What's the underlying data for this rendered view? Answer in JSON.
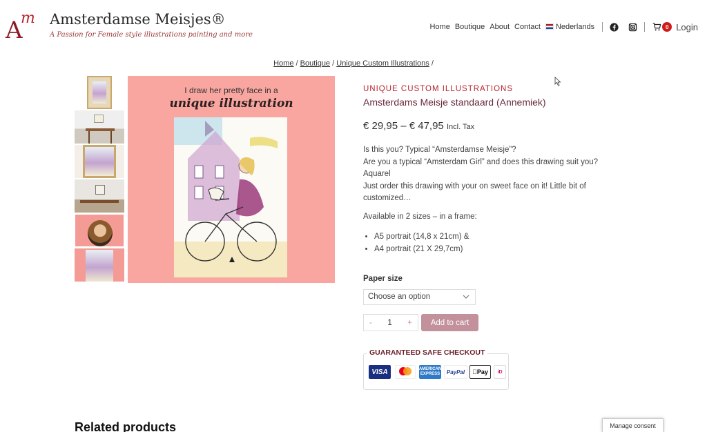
{
  "header": {
    "site_title": "Amsterdamse Meisjes®",
    "tagline": "A Passion for Female style illustrations painting and more",
    "nav": [
      "Home",
      "Boutique",
      "About",
      "Contact"
    ],
    "language": "Nederlands",
    "cart_count": "0",
    "login": "Login",
    "icons": [
      "facebook-icon",
      "instagram-icon",
      "cart-icon",
      "netherlands-flag-icon"
    ]
  },
  "breadcrumb": {
    "items": [
      "Home",
      "Boutique",
      "Unique Custom Illustrations"
    ],
    "separator": "/"
  },
  "gallery": {
    "main_line1": "I draw her pretty face in a",
    "main_line2": "unique illustration"
  },
  "product": {
    "category": "UNIQUE CUSTOM ILLUSTRATIONS",
    "title": "Amsterdams Meisje standaard (Annemiek)",
    "price_range": "€ 29,95 – € 47,95",
    "tax_note": "Incl. Tax",
    "description": [
      "Is this you? Typical “Amsterdamse Meisje”?",
      "Are you a typical “Amsterdam Girl” and does this drawing suit you?",
      "Aquarel",
      "Just order this drawing with your on sweet face on it! Little bit of",
      "customized…"
    ],
    "sizes_intro": "Available in 2 sizes – in a frame:",
    "sizes": [
      "A5 portrait (14,8 x 21cm) &",
      "A4 portrait (21 X 29,7cm)"
    ],
    "paper_size_label": "Paper size",
    "select_placeholder": "Choose an option",
    "quantity": "1",
    "minus": "-",
    "plus": "+",
    "add_to_cart": "Add to cart",
    "checkout_title": "GUARANTEED SAFE CHECKOUT",
    "payment_methods": [
      "VISA",
      "mastercard",
      "AMERICAN EXPRESS",
      "PayPal",
      "Pay",
      "iD"
    ]
  },
  "related_title": "Related products",
  "consent_button": "Manage consent",
  "colors": {
    "brand": "#b8232c",
    "title": "#6a2a3a",
    "button": "#c2919b",
    "image_bg": "#f9a6a1"
  }
}
